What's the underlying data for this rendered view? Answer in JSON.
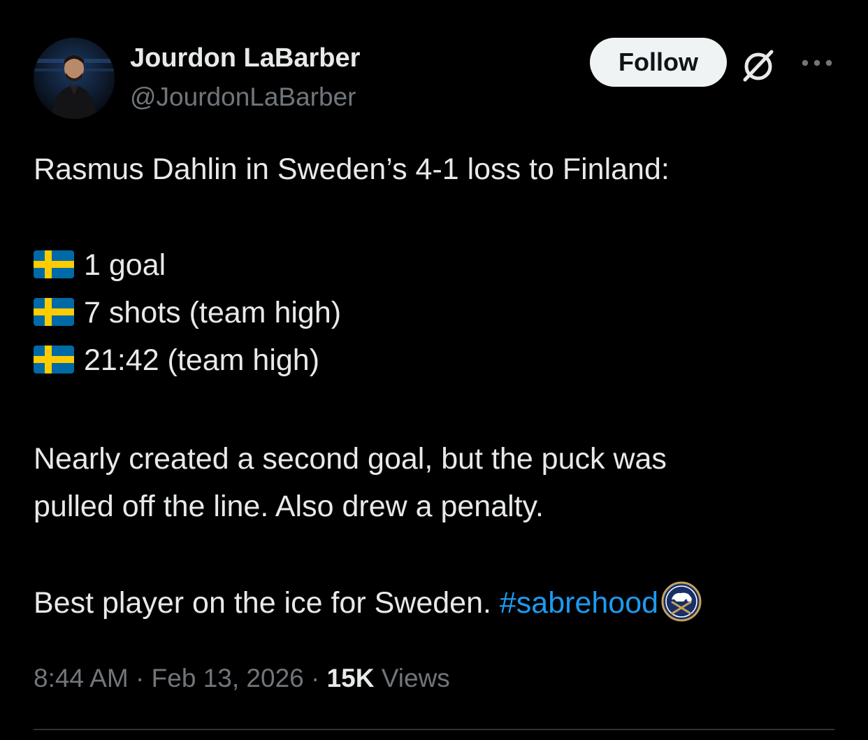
{
  "author": {
    "name": "Jourdon LaBarber",
    "handle": "@JourdonLaBarber",
    "avatar_icon": "profile-photo"
  },
  "actions": {
    "follow_label": "Follow",
    "grok_icon": "grok-icon",
    "more_icon": "more-horizontal-icon"
  },
  "tweet": {
    "intro": "Rasmus Dahlin in Sweden’s 4-1 loss to Finland:",
    "stats": [
      {
        "flag": "sweden-flag",
        "text": "1 goal"
      },
      {
        "flag": "sweden-flag",
        "text": "7 shots (team high)"
      },
      {
        "flag": "sweden-flag",
        "text": "21:42 (team high)"
      }
    ],
    "paragraph_line1": "Nearly created a second goal, but the puck was",
    "paragraph_line2": "pulled off the line. Also drew a penalty.",
    "closing": "Best player on the ice for Sweden. ",
    "hashtag": "#sabrehood",
    "hashtag_icon": "buffalo-sabres-logo"
  },
  "meta": {
    "time": "8:44 AM",
    "separator": " · ",
    "date": "Feb 13, 2026",
    "views_count": "15K",
    "views_label": " Views"
  },
  "colors": {
    "background": "#000000",
    "text": "#e7e9ea",
    "secondary": "#71767b",
    "link": "#1d9bf0",
    "follow_bg": "#eff3f4",
    "divider": "#2f3336",
    "flag_blue": "#006aa7",
    "flag_yellow": "#fecc00"
  }
}
